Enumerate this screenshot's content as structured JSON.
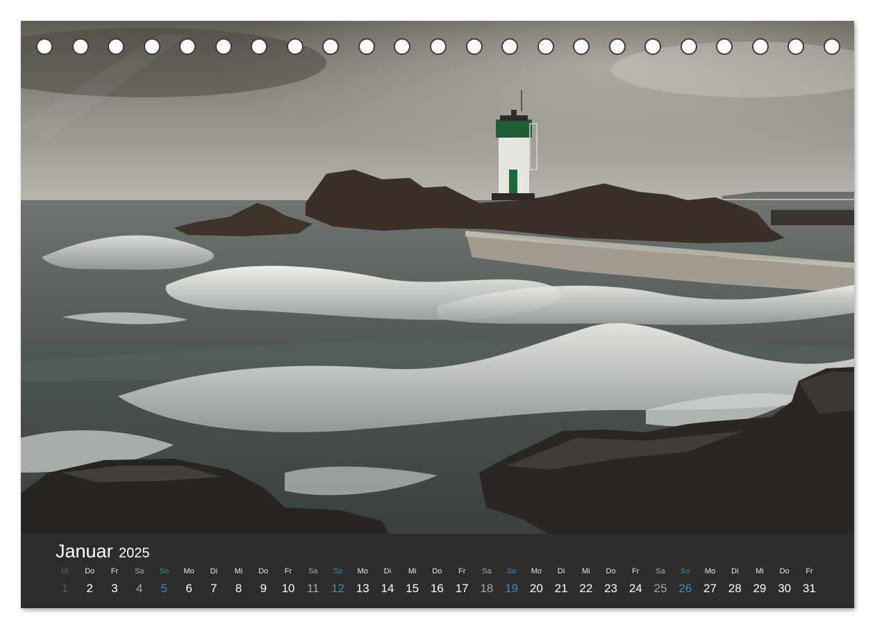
{
  "calendar": {
    "month": "Januar",
    "year": "2025",
    "colors": {
      "band": "#2c2c2c",
      "weekday": "#ffffff",
      "saturday": "#a9a9a9",
      "sunday": "#3f8fae"
    },
    "days": [
      {
        "dow": "Mi",
        "num": "1",
        "kind": "dim"
      },
      {
        "dow": "Do",
        "num": "2",
        "kind": "weekday"
      },
      {
        "dow": "Fr",
        "num": "3",
        "kind": "weekday"
      },
      {
        "dow": "Sa",
        "num": "4",
        "kind": "sat"
      },
      {
        "dow": "So",
        "num": "5",
        "kind": "sun"
      },
      {
        "dow": "Mo",
        "num": "6",
        "kind": "weekday"
      },
      {
        "dow": "Di",
        "num": "7",
        "kind": "weekday"
      },
      {
        "dow": "Mi",
        "num": "8",
        "kind": "weekday"
      },
      {
        "dow": "Do",
        "num": "9",
        "kind": "weekday"
      },
      {
        "dow": "Fr",
        "num": "10",
        "kind": "weekday"
      },
      {
        "dow": "Sa",
        "num": "11",
        "kind": "sat"
      },
      {
        "dow": "So",
        "num": "12",
        "kind": "sun"
      },
      {
        "dow": "Mo",
        "num": "13",
        "kind": "weekday"
      },
      {
        "dow": "Di",
        "num": "14",
        "kind": "weekday"
      },
      {
        "dow": "Mi",
        "num": "15",
        "kind": "weekday"
      },
      {
        "dow": "Do",
        "num": "16",
        "kind": "weekday"
      },
      {
        "dow": "Fr",
        "num": "17",
        "kind": "weekday"
      },
      {
        "dow": "Sa",
        "num": "18",
        "kind": "sat"
      },
      {
        "dow": "So",
        "num": "19",
        "kind": "sun"
      },
      {
        "dow": "Mo",
        "num": "20",
        "kind": "weekday"
      },
      {
        "dow": "Di",
        "num": "21",
        "kind": "weekday"
      },
      {
        "dow": "Mi",
        "num": "22",
        "kind": "weekday"
      },
      {
        "dow": "Do",
        "num": "23",
        "kind": "weekday"
      },
      {
        "dow": "Fr",
        "num": "24",
        "kind": "weekday"
      },
      {
        "dow": "Sa",
        "num": "25",
        "kind": "sat"
      },
      {
        "dow": "So",
        "num": "26",
        "kind": "sun"
      },
      {
        "dow": "Mo",
        "num": "27",
        "kind": "weekday"
      },
      {
        "dow": "Di",
        "num": "28",
        "kind": "weekday"
      },
      {
        "dow": "Mi",
        "num": "29",
        "kind": "weekday"
      },
      {
        "dow": "Do",
        "num": "30",
        "kind": "weekday"
      },
      {
        "dow": "Fr",
        "num": "31",
        "kind": "weekday"
      }
    ]
  },
  "binding": {
    "hole_count": 23
  }
}
